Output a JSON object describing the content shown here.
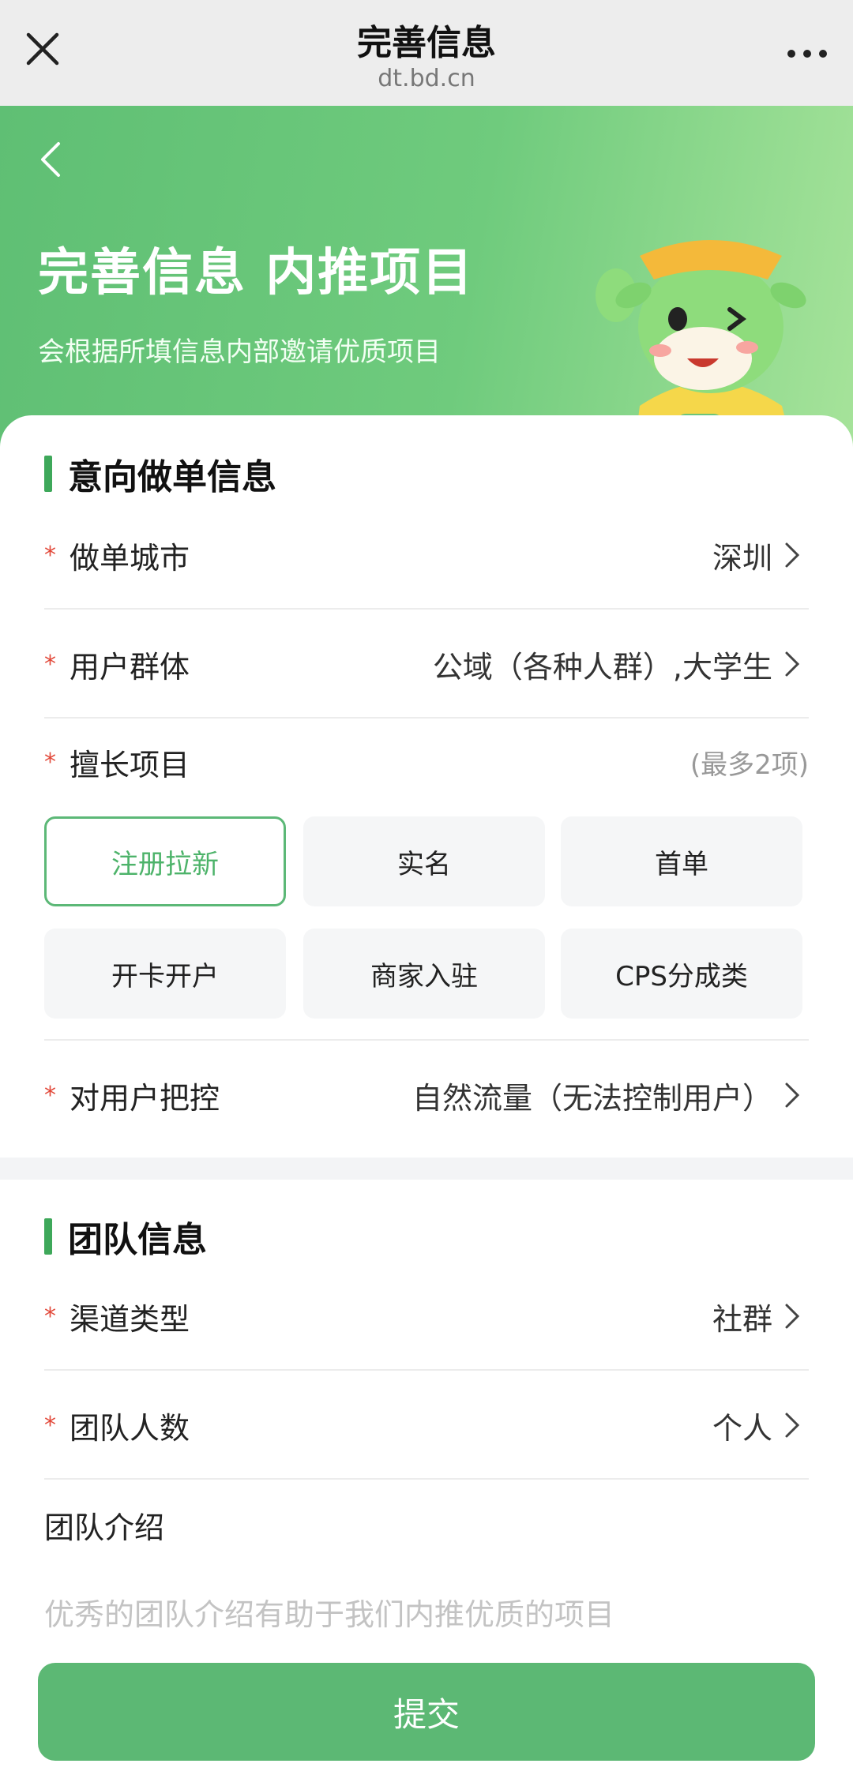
{
  "browser": {
    "title": "完善信息",
    "url": "dt.bd.cn",
    "close_icon": "close-icon",
    "more_icon": "more-icon"
  },
  "hero": {
    "title": "完善信息 内推项目",
    "subtitle": "会根据所填信息内部邀请优质项目",
    "back_icon": "back-icon",
    "accent": "#5fbf74"
  },
  "intent": {
    "section_title": "意向做单信息",
    "city": {
      "label": "做单城市",
      "value": "深圳"
    },
    "user_group": {
      "label": "用户群体",
      "value": "公域（各种人群）,大学生"
    },
    "skills": {
      "label": "擅长项目",
      "hint": "(最多2项)",
      "options": [
        "注册拉新",
        "实名",
        "首单",
        "开卡开户",
        "商家入驻",
        "CPS分成类"
      ],
      "selected": "注册拉新"
    },
    "control": {
      "label": "对用户把控",
      "value": "自然流量（无法控制用户）"
    }
  },
  "team": {
    "section_title": "团队信息",
    "channel": {
      "label": "渠道类型",
      "value": "社群"
    },
    "size": {
      "label": "团队人数",
      "value": "个人"
    },
    "intro_label": "团队介绍",
    "intro_placeholder": "优秀的团队介绍有助于我们内推优质的项目"
  },
  "submit_label": "提交",
  "colors": {
    "primary": "#5cb874",
    "required": "#e24a3b"
  }
}
